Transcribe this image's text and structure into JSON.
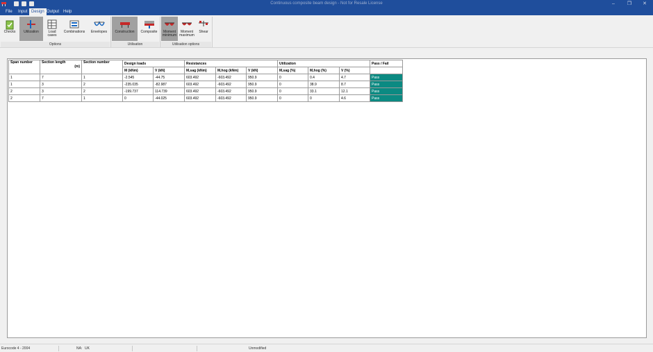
{
  "window": {
    "title": "Continuous composite beam design - Not for Resale License",
    "minimize": "–",
    "restore": "❐",
    "close": "✕"
  },
  "menu": [
    "File",
    "Input",
    "Design",
    "Output",
    "Help"
  ],
  "ribbon": {
    "buttons": {
      "checks": "Checks",
      "utilization": "Utilization",
      "load_cases_1": "Load",
      "load_cases_2": "cases",
      "combinations": "Combinations",
      "envelopes": "Envelopes",
      "construction": "Construction",
      "composite": "Composite",
      "moment_min_1": "Moment",
      "moment_min_2": "minimum",
      "moment_max_1": "Moment",
      "moment_max_2": "maximum",
      "shear": "Shear"
    },
    "groups": {
      "options": "Options",
      "utilisation": "Utilisation",
      "utilisation_options": "Utilisation options"
    }
  },
  "table": {
    "headers": {
      "span_number": "Span number",
      "section_length": "Section length",
      "section_length_unit": "(m)",
      "section_number": "Section number",
      "design_loads": "Design loads",
      "resistances": "Resistances",
      "utilization": "Utilization",
      "pass_fail": "Pass / Fail"
    },
    "subheaders": [
      "M (kNm)",
      "V (kN)",
      "M,sag (kNm)",
      "M,hog (kNm)",
      "V (kN)",
      "M,sag (%)",
      "M,hog (%)",
      "V (%)"
    ],
    "rows": [
      [
        "1",
        "7",
        "1",
        "-2.545",
        "-44.75",
        "603.492",
        "-603.492",
        "950.9",
        "0",
        "0.4",
        "4.7",
        "Pass"
      ],
      [
        "1",
        "3",
        "2",
        "-235.035",
        "-82.987",
        "603.492",
        "-603.492",
        "950.9",
        "0",
        "38.9",
        "8.7",
        "Pass"
      ],
      [
        "2",
        "3",
        "2",
        "-199.737",
        "114.739",
        "603.492",
        "-603.492",
        "950.9",
        "0",
        "33.1",
        "12.1",
        "Pass"
      ],
      [
        "2",
        "7",
        "1",
        "0",
        "-44.025",
        "603.492",
        "-603.492",
        "950.9",
        "0",
        "0",
        "4.6",
        "Pass"
      ]
    ]
  },
  "status": {
    "code": "Eurocode 4 - 2004",
    "na_label": "NA:",
    "na_value": "UK",
    "state": "Unmodified"
  },
  "colors": {
    "titlebar": "#1f4e9c",
    "pass": "#0b8a82",
    "selected": "#a0a0a0"
  }
}
